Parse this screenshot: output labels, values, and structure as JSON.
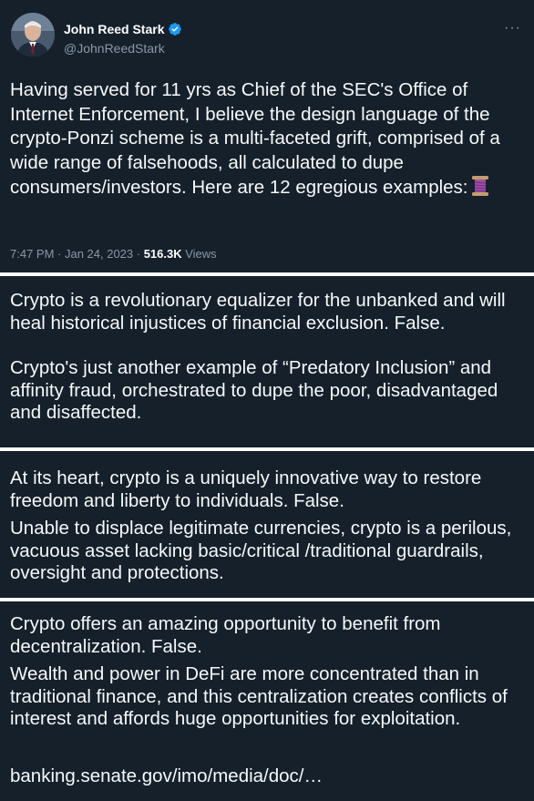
{
  "tweet": {
    "author_name": "John Reed Stark",
    "author_handle": "@JohnReedStark",
    "more_label": "···",
    "text": "Having served for 11 yrs as Chief of the SEC's Office of Internet Enforcement, I believe the design language of the crypto-Ponzi scheme is a multi-faceted grift, comprised of a wide range of falsehoods, all calculated to dupe consumers/investors. Here are 12 egregious examples:",
    "thread_emoji_icon": "thread-spool-icon",
    "timestamp": "7:47 PM · Jan 24, 2023 · ",
    "views_count": "516.3K",
    "views_label": " Views"
  },
  "replies": [
    {
      "line1": "Crypto is a revolutionary equalizer for the unbanked and will heal historical injustices of financial exclusion. False.",
      "line2": "Crypto's just another example of “Predatory Inclusion” and affinity fraud, orchestrated to dupe the poor, disadvantaged and disaffected."
    },
    {
      "line1": "At its heart, crypto is a uniquely innovative way to restore freedom and liberty to individuals. False.",
      "line2": "Unable to displace legitimate currencies, crypto is a perilous, vacuous asset lacking basic/critical /traditional guardrails, oversight and protections."
    },
    {
      "line1": "Crypto offers an amazing opportunity to benefit from decentralization. False.",
      "line2": "Wealth and power in DeFi are more concentrated than in traditional finance, and this centralization creates conflicts of interest and affords huge opportunities for exploitation.",
      "link": "banking.senate.gov/imo/media/doc/…"
    }
  ],
  "colors": {
    "background": "#15202b",
    "text": "#f7f9f9",
    "secondary": "#8b98a5",
    "link": "#1d9bf0",
    "verified": "#1d9bf0",
    "divider": "#ffffff"
  }
}
